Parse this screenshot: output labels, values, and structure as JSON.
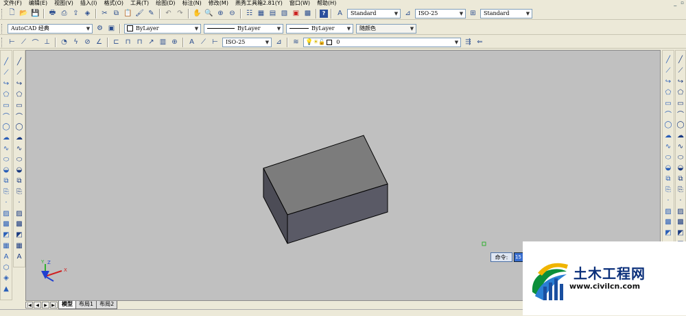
{
  "menu": [
    "文件(F)",
    "编辑(E)",
    "视图(V)",
    "插入(I)",
    "格式(O)",
    "工具(T)",
    "绘图(D)",
    "标注(N)",
    "修改(M)",
    "燕秀工具箱2.81(Y)",
    "窗口(W)",
    "帮助(H)"
  ],
  "toolbar1": {
    "text_style": "Standard",
    "dim_style": "ISO-25",
    "table_style": "Standard"
  },
  "toolbar2": {
    "workspace": "AutoCAD 经典",
    "color": "ByLayer",
    "linetype": "ByLayer",
    "lineweight": "ByLayer",
    "plot_style": "随颜色"
  },
  "toolbar3": {
    "dim_style": "ISO-25",
    "layer": "0"
  },
  "ucs": {
    "x": "X",
    "y": "Y",
    "z": "Z"
  },
  "command": {
    "label": "命令:",
    "value": "15"
  },
  "tabs": [
    "模型",
    "布局1",
    "布局2"
  ],
  "watermark": {
    "title": "土木工程网",
    "url": "www.civilcn.com"
  },
  "left_draw_icons": [
    "line-icon",
    "construction-line-icon",
    "polyline-icon",
    "polygon-icon",
    "rectangle-icon",
    "arc-icon",
    "circle-icon",
    "revision-cloud-icon",
    "spline-icon",
    "ellipse-icon",
    "ellipse-arc-icon",
    "insert-block-icon",
    "make-block-icon",
    "point-icon",
    "hatch-icon",
    "gradient-icon",
    "region-icon",
    "table-icon",
    "mtext-icon"
  ],
  "left_3d_icons": [
    "box-icon",
    "wedge-icon",
    "cone-icon",
    "sphere-icon",
    "cylinder-icon",
    "torus-icon",
    "pyramid-icon",
    "extrude-icon",
    "revolve-icon",
    "sweep-icon",
    "loft-icon",
    "planar-surface-icon",
    "polysolid-icon",
    "helix-icon",
    "union-icon",
    "subtract-icon",
    "intersect-icon",
    "slice-icon",
    "section-icon",
    "flatshot-icon",
    "move-3d-icon",
    "rotate-3d-icon",
    "align-3d-icon",
    "array-3d-icon",
    "mirror-3d-icon",
    "explode-icon"
  ],
  "right_view_icons": [
    "ucs-icon",
    "top-view-icon",
    "bottom-view-icon",
    "left-view-icon",
    "right-view-icon",
    "front-view-icon",
    "back-view-icon",
    "sw-iso-icon",
    "se-iso-icon",
    "ne-iso-icon",
    "nw-iso-icon",
    "camera-icon",
    "orbit-icon",
    "visual-style-2d-icon",
    "visual-style-3d-icon",
    "hidden-icon",
    "realistic-icon",
    "conceptual-icon",
    "render-icon"
  ],
  "right_modify_icons": [
    "erase-icon",
    "copy-icon",
    "mirror-icon",
    "offset-icon",
    "array-icon",
    "move-icon",
    "rotate-icon",
    "scale-icon",
    "stretch-icon",
    "trim-icon",
    "extend-icon",
    "break-at-point-icon",
    "break-icon",
    "join-icon",
    "chamfer-icon",
    "fillet-icon",
    "explode-modify-icon",
    "properties-icon",
    "dist-icon",
    "area-icon",
    "list-icon"
  ]
}
